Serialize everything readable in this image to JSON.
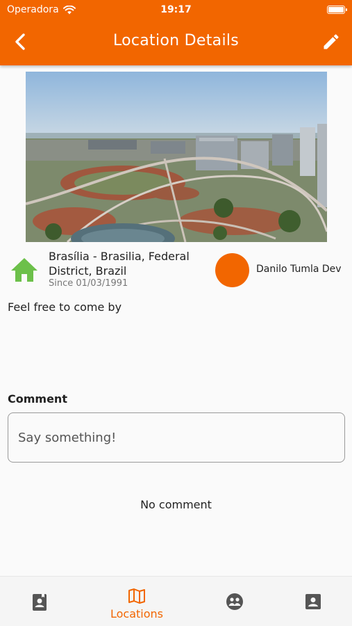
{
  "status_bar": {
    "carrier": "Operadora",
    "time": "19:17",
    "battery_level": 0.9
  },
  "app_bar": {
    "title": "Location Details",
    "back_icon": "chevron-left-icon",
    "edit_icon": "pencil-icon"
  },
  "location": {
    "name": "Brasília - Brasilia, Federal District, Brazil",
    "since": "Since 01/03/1991",
    "owner": "Danilo Tumla Dev",
    "description": "Feel free to come by",
    "type_icon": "home-icon",
    "type_icon_color": "#6cc04a",
    "avatar_color": "#f26600"
  },
  "comments": {
    "label": "Comment",
    "placeholder": "Say something!",
    "empty_text": "No comment"
  },
  "bottom_nav": {
    "accent": "#f26600",
    "inactive_color": "#555555",
    "items": [
      {
        "icon": "contacts-book-icon",
        "label": "",
        "active": false
      },
      {
        "icon": "map-icon",
        "label": "Locations",
        "active": true
      },
      {
        "icon": "community-icon",
        "label": "",
        "active": false
      },
      {
        "icon": "profile-card-icon",
        "label": "",
        "active": false
      }
    ]
  }
}
